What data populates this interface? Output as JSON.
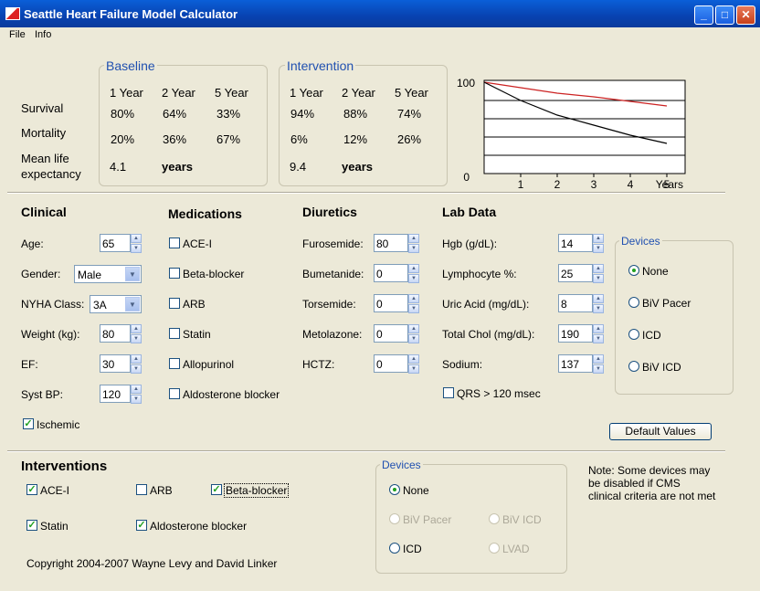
{
  "window": {
    "title": "Seattle Heart Failure Model Calculator"
  },
  "menu": {
    "file": "File",
    "info": "Info"
  },
  "summary": {
    "row_survival": "Survival",
    "row_mortality": "Mortality",
    "row_mle_1": "Mean life",
    "row_mle_2": "expectancy",
    "baseline": {
      "title": "Baseline",
      "headers": [
        "1 Year",
        "2 Year",
        "5 Year"
      ],
      "survival": [
        "80%",
        "64%",
        "33%"
      ],
      "mortality": [
        "20%",
        "36%",
        "67%"
      ],
      "mle_value": "4.1",
      "mle_unit": "years"
    },
    "intervention": {
      "title": "Intervention",
      "headers": [
        "1 Year",
        "2 Year",
        "5 Year"
      ],
      "survival": [
        "94%",
        "88%",
        "74%"
      ],
      "mortality": [
        "6%",
        "12%",
        "26%"
      ],
      "mle_value": "9.4",
      "mle_unit": "years"
    }
  },
  "chart_data": {
    "type": "line",
    "x_label": "Years",
    "xlim": [
      0,
      5
    ],
    "ylim": [
      0,
      100
    ],
    "x_ticks": [
      "1",
      "2",
      "3",
      "4",
      "5"
    ],
    "y_ticks": [
      "100",
      "0"
    ],
    "series": [
      {
        "color": "#cc2222",
        "x": [
          0,
          1,
          2,
          3,
          4,
          5
        ],
        "y": [
          100,
          94,
          88,
          84,
          79,
          74
        ]
      },
      {
        "color": "#000000",
        "x": [
          0,
          1,
          2,
          3,
          4,
          5
        ],
        "y": [
          100,
          80,
          64,
          53,
          42,
          33
        ]
      }
    ],
    "grid": true
  },
  "clinical": {
    "title": "Clinical",
    "age_label": "Age:",
    "age": "65",
    "gender_label": "Gender:",
    "gender": "Male",
    "nyha_label": "NYHA Class:",
    "nyha": "3A",
    "weight_label": "Weight (kg):",
    "weight": "80",
    "ef_label": "EF:",
    "ef": "30",
    "sbp_label": "Syst BP:",
    "sbp": "120",
    "ischemic_label": "Ischemic",
    "ischemic": true
  },
  "medications": {
    "title": "Medications",
    "items": [
      {
        "label": "ACE-I",
        "checked": false
      },
      {
        "label": "Beta-blocker",
        "checked": false
      },
      {
        "label": "ARB",
        "checked": false
      },
      {
        "label": "Statin",
        "checked": false
      },
      {
        "label": "Allopurinol",
        "checked": false
      },
      {
        "label": "Aldosterone blocker",
        "checked": false
      }
    ]
  },
  "diuretics": {
    "title": "Diuretics",
    "items": [
      {
        "label": "Furosemide:",
        "value": "80"
      },
      {
        "label": "Bumetanide:",
        "value": "0"
      },
      {
        "label": "Torsemide:",
        "value": "0"
      },
      {
        "label": "Metolazone:",
        "value": "0"
      },
      {
        "label": "HCTZ:",
        "value": "0"
      }
    ]
  },
  "lab": {
    "title": "Lab Data",
    "items": [
      {
        "label": "Hgb (g/dL):",
        "value": "14"
      },
      {
        "label": "Lymphocyte %:",
        "value": "25"
      },
      {
        "label": "Uric Acid (mg/dL):",
        "value": "8"
      },
      {
        "label": "Total Chol (mg/dL):",
        "value": "190"
      },
      {
        "label": "Sodium:",
        "value": "137"
      }
    ],
    "qrs_label": "QRS > 120 msec",
    "qrs": false
  },
  "devices": {
    "title": "Devices",
    "options": [
      "None",
      "BiV Pacer",
      "ICD",
      "BiV ICD"
    ],
    "selected": "None"
  },
  "default_button": "Default Values",
  "interventions": {
    "title": "Interventions",
    "items": [
      {
        "label": "ACE-I",
        "checked": true
      },
      {
        "label": "ARB",
        "checked": false
      },
      {
        "label": "Beta-blocker",
        "checked": true
      },
      {
        "label": "Statin",
        "checked": true
      },
      {
        "label": "Aldosterone blocker",
        "checked": true
      }
    ],
    "devices_title": "Devices",
    "device_options": [
      {
        "label": "None",
        "enabled": true,
        "selected": true
      },
      {
        "label": "BiV Pacer",
        "enabled": false,
        "selected": false
      },
      {
        "label": "BiV ICD",
        "enabled": false,
        "selected": false
      },
      {
        "label": "ICD",
        "enabled": true,
        "selected": false
      },
      {
        "label": "LVAD",
        "enabled": false,
        "selected": false
      }
    ],
    "note": "Note: Some devices may be disabled if CMS clinical criteria are not met"
  },
  "copyright": "Copyright 2004-2007 Wayne Levy and David Linker"
}
